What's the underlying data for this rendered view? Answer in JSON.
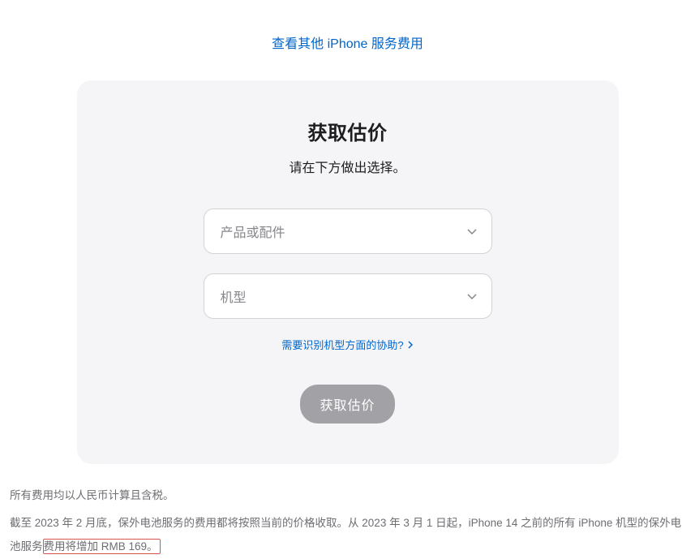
{
  "topLink": "查看其他 iPhone 服务费用",
  "card": {
    "title": "获取估价",
    "subtitle": "请在下方做出选择。",
    "select1": {
      "placeholder": "产品或配件"
    },
    "select2": {
      "placeholder": "机型"
    },
    "helpLink": "需要识别机型方面的协助?",
    "submit": "获取估价"
  },
  "footer": {
    "line1": "所有费用均以人民币计算且含税。",
    "line2_part1": "截至 2023 年 2 月底，保外电池服务的费用都将按照当前的价格收取。从 2023 年 3 月 1 日起，iPhone 14 之前的所有 iPhone 机型的保外电池服务",
    "line2_highlight": "费用将增加 RMB 169。"
  }
}
